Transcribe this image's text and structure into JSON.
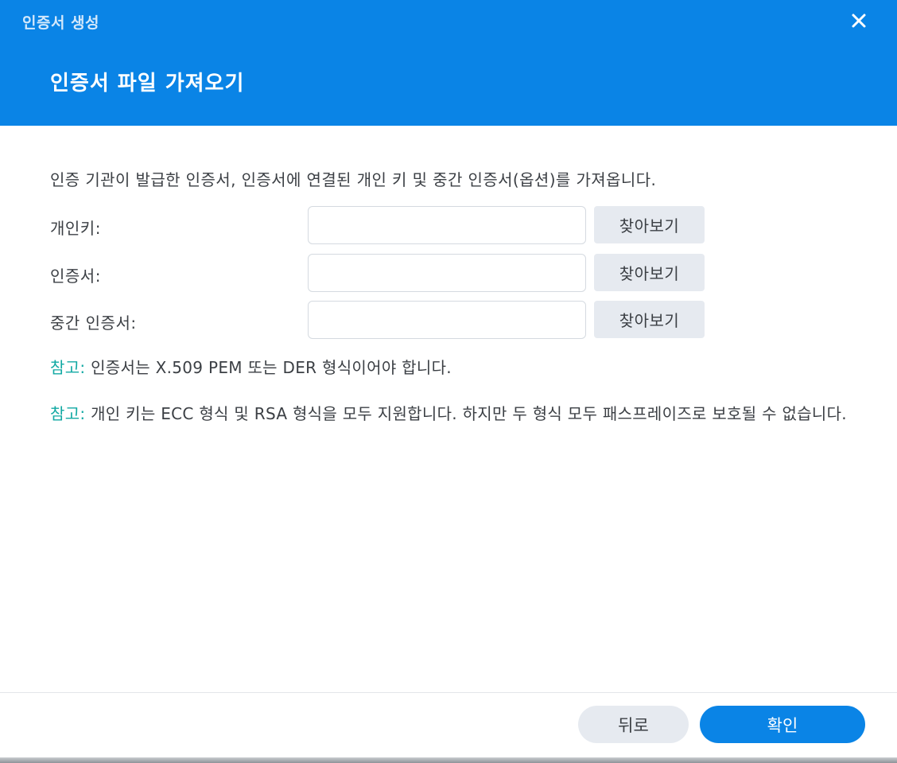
{
  "window": {
    "title": "인증서 생성",
    "close_icon": "close-icon"
  },
  "header": {
    "title": "인증서 파일 가져오기"
  },
  "description": "인증 기관이 발급한 인증서, 인증서에 연결된 개인 키 및 중간 인증서(옵션)를 가져옵니다.",
  "form": {
    "rows": [
      {
        "label": "개인키:",
        "value": "",
        "browse_label": "찾아보기"
      },
      {
        "label": "인증서:",
        "value": "",
        "browse_label": "찾아보기"
      },
      {
        "label": "중간 인증서:",
        "value": "",
        "browse_label": "찾아보기"
      }
    ]
  },
  "notes": [
    {
      "prefix": "참고:",
      "text": " 인증서는 X.509 PEM 또는 DER 형식이어야 합니다."
    },
    {
      "prefix": "참고:",
      "text": " 개인 키는 ECC 형식 및 RSA 형식을 모두 지원합니다. 하지만 두 형식 모두 패스프레이즈로 보호될 수 없습니다."
    }
  ],
  "footer": {
    "back_label": "뒤로",
    "confirm_label": "확인"
  },
  "colors": {
    "header_bg": "#0a84e6",
    "note_prefix": "#12a9a3",
    "primary_button": "#0a84e6",
    "secondary_button": "#e6eaf0"
  }
}
